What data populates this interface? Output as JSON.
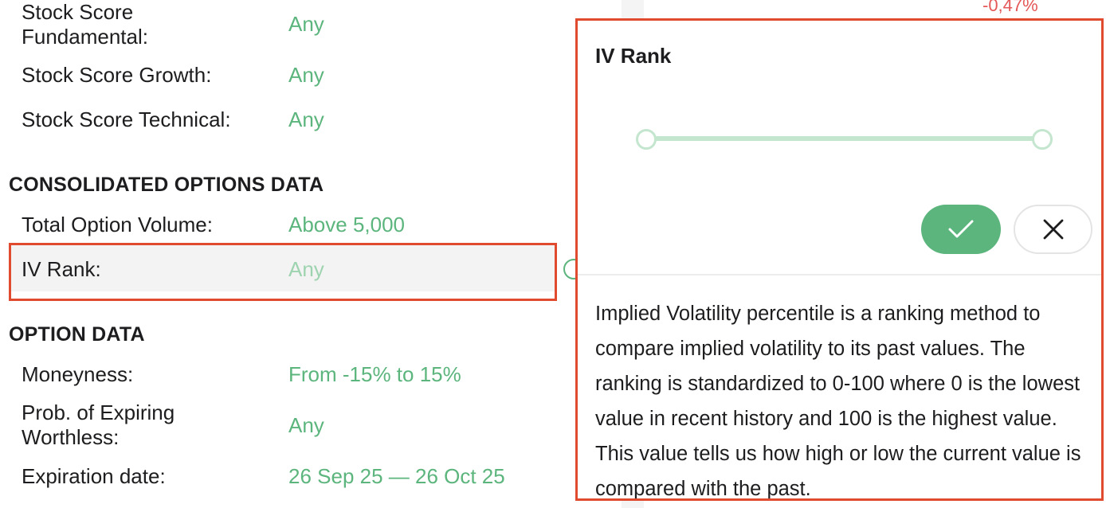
{
  "screener": {
    "stock_scores": [
      {
        "label": "Stock Score Fundamental:",
        "value": "Any"
      },
      {
        "label": "Stock Score Growth:",
        "value": "Any"
      },
      {
        "label": "Stock Score Technical:",
        "value": "Any"
      }
    ],
    "consolidated_section": "CONSOLIDATED OPTIONS DATA",
    "consolidated_rows": [
      {
        "label": "Total Option Volume:",
        "value": "Above 5,000"
      },
      {
        "label": "IV Rank:",
        "value": "Any"
      }
    ],
    "option_section": "OPTION DATA",
    "option_rows": [
      {
        "label": "Moneyness:",
        "value": "From -15% to 15%"
      },
      {
        "label": "Prob. of Expiring Worthless:",
        "value": "Any"
      },
      {
        "label": "Expiration date:",
        "value": "26 Sep 25 — 26 Oct 25"
      }
    ]
  },
  "background": {
    "change_pct": "-0,47%"
  },
  "popover": {
    "title": "IV Rank",
    "slider": {
      "min_fraction": 0.0,
      "max_fraction": 1.0
    },
    "confirm_icon": "check-icon",
    "cancel_icon": "close-icon",
    "description": "Implied Volatility percentile is a ranking method to compare implied volatility to its past values. The ranking is standardized to 0-100 where 0 is the lowest value in recent history and 100 is the highest value. This value tells us how high or low the current value is compared with the past."
  },
  "colors": {
    "accent": "#5cb57d",
    "highlight_outline": "#e04a2f",
    "negative": "#e45858",
    "slider": "#c4e6cf"
  }
}
